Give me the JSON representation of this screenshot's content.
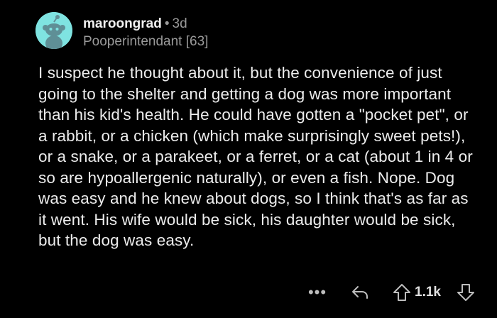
{
  "comment": {
    "username": "maroongrad",
    "separator": "•",
    "age": "3d",
    "flair": "Pooperintendant [63]",
    "body": "I suspect he thought about it, but the convenience of just going to the shelter and getting a dog was more important than his kid's health. He could have gotten a \"pocket pet\", or a rabbit, or a chicken (which make surprisingly sweet pets!), or a snake, or a parakeet, or a ferret, or a cat (about 1 in 4 or so are hypoallergenic naturally), or even a fish. Nope. Dog was easy and he knew about dogs, so I think that's as far as it went. His wife would be sick, his daughter would be sick, but the dog was easy."
  },
  "actions": {
    "more_label": "•••",
    "vote_count": "1.1k",
    "icons": [
      "more-icon",
      "reply-icon",
      "upvote-icon",
      "downvote-icon"
    ]
  },
  "colors": {
    "background": "#000000",
    "avatar": "#7fe3e1",
    "text": "#ececec",
    "muted": "#9a9a9a"
  }
}
